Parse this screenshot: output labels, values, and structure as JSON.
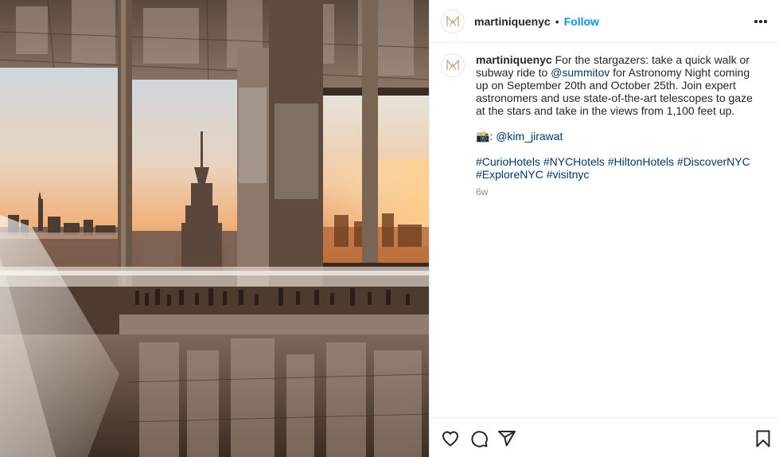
{
  "post": {
    "username": "martiniquenyc",
    "separator": "•",
    "follow_label": "Follow",
    "caption": {
      "username": "martiniquenyc",
      "line1_before": "For the stargazers: take a quick walk or subway ride to ",
      "mention": "@summitov",
      "line1_after": " for Astronomy Night coming up on September 20th and October 25th. Join expert astronomers and use state-of-the-art telescopes to gaze at the stars and take in the views from 1,100 feet up.",
      "credit_emoji": "📸",
      "credit_sep": ": ",
      "credit_handle": "@kim_jirawat",
      "hashtags": [
        "#CurioHotels",
        "#NYCHotels",
        "#HiltonHotels",
        "#DiscoverNYC",
        "#ExploreNYC",
        "#visitnyc"
      ]
    },
    "time": "6w"
  },
  "icons": {
    "avatar": "martinique-monogram-logo",
    "more": "more-options-icon",
    "like": "heart-icon",
    "comment": "comment-icon",
    "share": "share-icon",
    "save": "bookmark-icon"
  },
  "colors": {
    "link": "#00376b",
    "follow": "#0095f6",
    "text": "#262626",
    "muted": "#8e8e8e",
    "logo_gold": "#c9a27a"
  }
}
